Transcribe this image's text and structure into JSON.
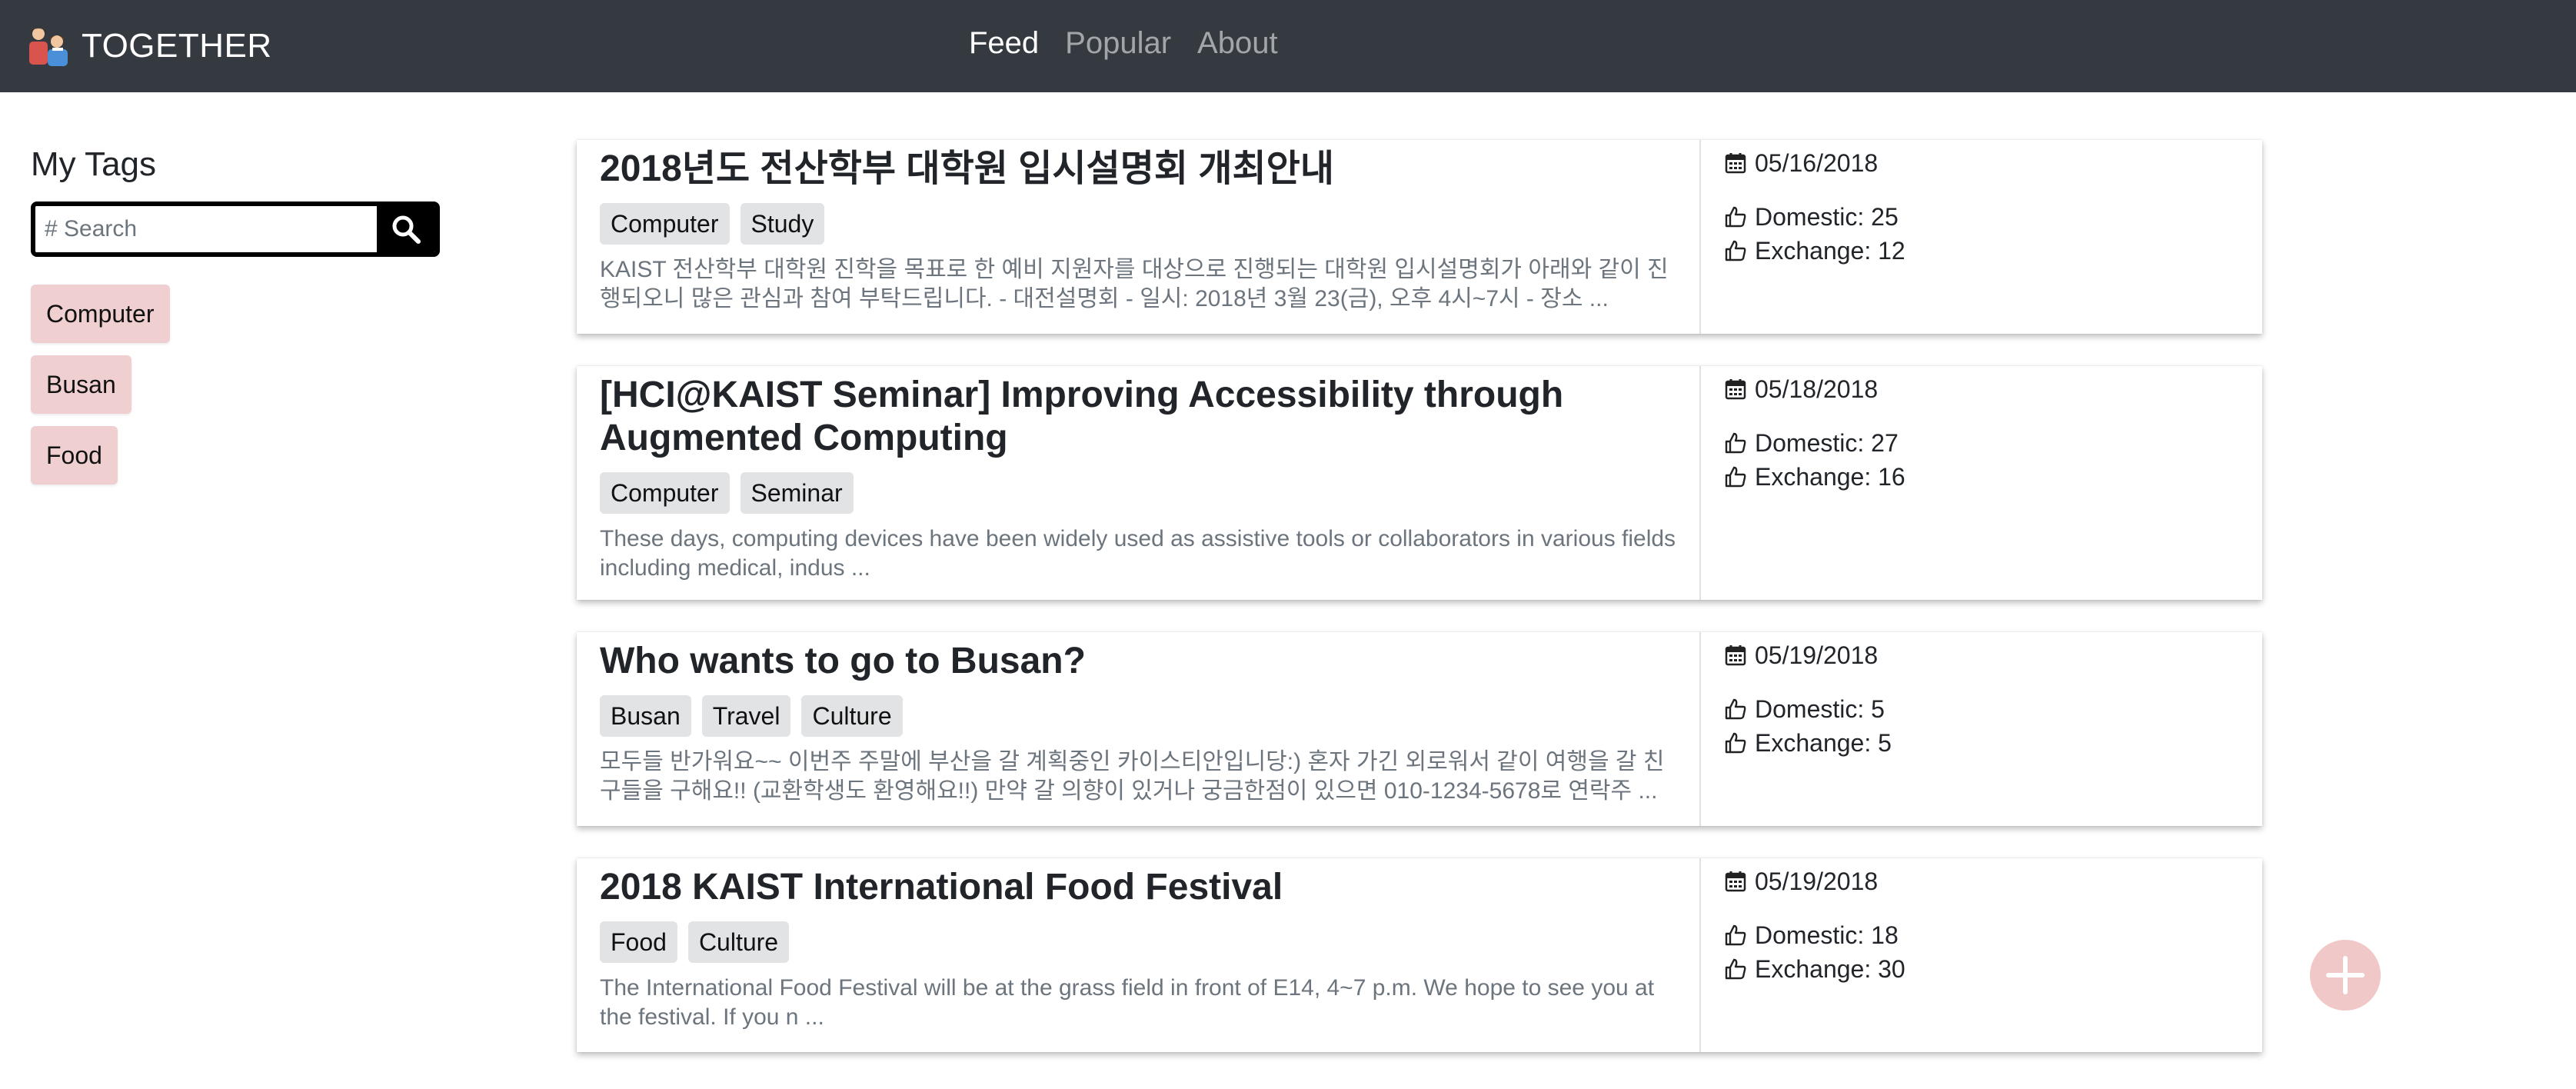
{
  "app": {
    "brand": "TOGETHER"
  },
  "nav": {
    "items": [
      {
        "label": "Feed",
        "active": true
      },
      {
        "label": "Popular",
        "active": false
      },
      {
        "label": "About",
        "active": false
      }
    ]
  },
  "sidebar": {
    "title": "My Tags",
    "search_placeholder": "# Search",
    "tags": [
      "Computer",
      "Busan",
      "Food"
    ]
  },
  "posts": [
    {
      "title": "2018년도 전산학부 대학원 입시설명회 개최안내",
      "tags": [
        "Computer",
        "Study"
      ],
      "description": "KAIST 전산학부 대학원 진학을 목표로 한 예비 지원자를 대상으로 진행되는 대학원 입시설명회가 아래와 같이 진행되오니 많은 관심과 참여 부탁드립니다. - 대전설명회 - 일시: 2018년 3월 23(금), 오후 4시~7시 - 장소 ...",
      "date": "05/16/2018",
      "domestic": "Domestic: 25",
      "exchange": "Exchange: 12"
    },
    {
      "title": "[HCI@KAIST Seminar] Improving Accessibility through Augmented Computing",
      "tags": [
        "Computer",
        "Seminar"
      ],
      "description": "These days, computing devices have been widely used as assistive tools or collaborators in various fields including medical, indus ...",
      "date": "05/18/2018",
      "domestic": "Domestic: 27",
      "exchange": "Exchange: 16"
    },
    {
      "title": "Who wants to go to Busan?",
      "tags": [
        "Busan",
        "Travel",
        "Culture"
      ],
      "description": "모두들 반가워요~~ 이번주 주말에 부산을 갈 계획중인 카이스티안입니당:) 혼자 가긴 외로워서 같이 여행을 갈 친구들을 구해요!! (교환학생도 환영해요!!) 만약 갈 의향이 있거나 궁금한점이 있으면 010-1234-5678로 연락주 ...",
      "date": "05/19/2018",
      "domestic": "Domestic: 5",
      "exchange": "Exchange: 5"
    },
    {
      "title": "2018 KAIST International Food Festival",
      "tags": [
        "Food",
        "Culture"
      ],
      "description": "The International Food Festival will be at the grass field in front of E14, 4~7 p.m. We hope to see you at the festival. If you n ...",
      "date": "05/19/2018",
      "domestic": "Domestic: 18",
      "exchange": "Exchange: 30"
    }
  ],
  "colors": {
    "navbar": "#343a40",
    "tag_pink": "#efcfcf",
    "chip_gray": "#e2e3e5",
    "fab": "#f0c8c8"
  },
  "icons": [
    "people-logo-icon",
    "search-icon",
    "calendar-icon",
    "thumbs-up-icon",
    "plus-icon"
  ]
}
